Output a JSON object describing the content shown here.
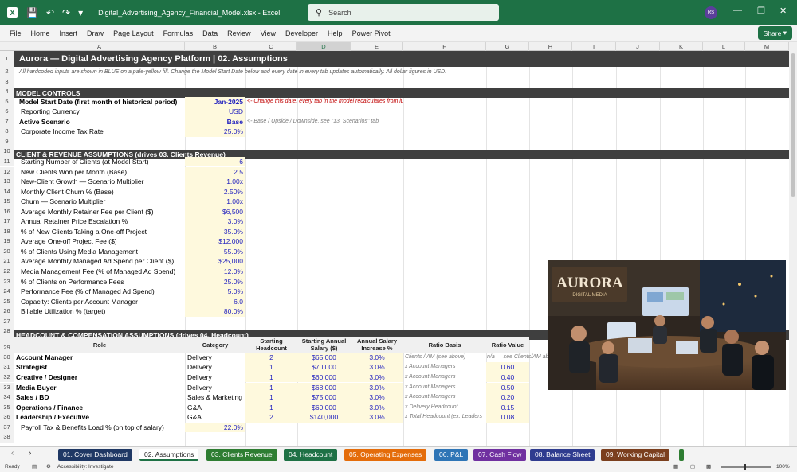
{
  "titlebar": {
    "filename": "Digital_Advertising_Agency_Financial_Model.xlsx",
    "app": "Excel",
    "search_placeholder": "Search",
    "avatar_initials": "RS"
  },
  "menu": [
    "File",
    "Home",
    "Insert",
    "Draw",
    "Page Layout",
    "Formulas",
    "Data",
    "Review",
    "View",
    "Developer",
    "Help",
    "Power Pivot"
  ],
  "share_label": "Share",
  "columns": [
    "A",
    "B",
    "C",
    "D",
    "E",
    "F",
    "G",
    "H",
    "I",
    "J",
    "K",
    "L",
    "M"
  ],
  "selected_column": "D",
  "rows": [
    "1",
    "2",
    "3",
    "4",
    "5",
    "6",
    "7",
    "8",
    "9",
    "10",
    "11",
    "12",
    "13",
    "14",
    "15",
    "16",
    "17",
    "18",
    "19",
    "20",
    "21",
    "22",
    "23",
    "24",
    "25",
    "26",
    "27",
    "28",
    "29",
    "30",
    "31",
    "32",
    "33",
    "34",
    "35",
    "36",
    "37",
    "38"
  ],
  "sheet": {
    "title": "Aurora — Digital Advertising Agency Platform  |  02. Assumptions",
    "subtitle": "All hardcoded inputs are shown in BLUE on a pale-yellow fill. Change the Model Start Date below and every date in every tab updates automatically. All dollar figures in USD.",
    "section_model_controls": "MODEL CONTROLS",
    "controls": [
      {
        "label": "Model Start Date  (first month of historical period)",
        "value": "Jan-2025",
        "bold": true,
        "note": "<- Change this date, every tab in the model recalculates from it.",
        "note_style": "red"
      },
      {
        "label": "Reporting Currency",
        "value": "USD",
        "bold": false,
        "note": "",
        "note_style": ""
      },
      {
        "label": "Active Scenario",
        "value": "Base",
        "bold": true,
        "note": "<- Base / Upside / Downside, see \"13. Scenarios\" tab",
        "note_style": "gray"
      },
      {
        "label": "Corporate Income Tax Rate",
        "value": "25.0%",
        "bold": false,
        "note": "",
        "note_style": ""
      }
    ],
    "section_client_revenue": "CLIENT & REVENUE ASSUMPTIONS  (drives 03. Clients Revenue)",
    "client_rows": [
      {
        "label": "Starting Number of Clients (at Model Start)",
        "value": "6"
      },
      {
        "label": "New Clients Won per Month (Base)",
        "value": "2.5"
      },
      {
        "label": "New-Client Growth — Scenario Multiplier",
        "value": "1.00x"
      },
      {
        "label": "Monthly Client Churn % (Base)",
        "value": "2.50%"
      },
      {
        "label": "Churn — Scenario Multiplier",
        "value": "1.00x"
      },
      {
        "label": "Average Monthly Retainer Fee per Client ($)",
        "value": "$6,500"
      },
      {
        "label": "Annual Retainer Price Escalation %",
        "value": "3.0%"
      },
      {
        "label": "% of New Clients Taking a One-off Project",
        "value": "35.0%"
      },
      {
        "label": "Average One-off Project Fee ($)",
        "value": "$12,000"
      },
      {
        "label": "% of Clients Using Media Management",
        "value": "55.0%"
      },
      {
        "label": "Average Monthly Managed Ad Spend per Client ($)",
        "value": "$25,000"
      },
      {
        "label": "Media Management Fee (% of Managed Ad Spend)",
        "value": "12.0%"
      },
      {
        "label": "% of Clients on Performance Fees",
        "value": "25.0%"
      },
      {
        "label": "Performance Fee (% of Managed Ad Spend)",
        "value": "5.0%"
      },
      {
        "label": "Capacity: Clients per Account Manager",
        "value": "6.0"
      },
      {
        "label": "Billable Utilization % (target)",
        "value": "80.0%"
      }
    ],
    "section_headcount": "HEADCOUNT & COMPENSATION ASSUMPTIONS  (drives 04. Headcount)",
    "headcount_headers": [
      "Role",
      "Category",
      "Starting Headcount",
      "Starting Annual Salary ($)",
      "Annual Salary Increase %",
      "Ratio Basis",
      "Ratio Value"
    ],
    "headcount_rows": [
      {
        "role": "Account Manager",
        "category": "Delivery",
        "headcount": "2",
        "salary": "$65,000",
        "increase": "3.0%",
        "basis": "Clients / AM (see above)",
        "ratio": "n/a — see Clients/AM above"
      },
      {
        "role": "Strategist",
        "category": "Delivery",
        "headcount": "1",
        "salary": "$70,000",
        "increase": "3.0%",
        "basis": "x Account Managers",
        "ratio": "0.60"
      },
      {
        "role": "Creative / Designer",
        "category": "Delivery",
        "headcount": "1",
        "salary": "$60,000",
        "increase": "3.0%",
        "basis": "x Account Managers",
        "ratio": "0.40"
      },
      {
        "role": "Media Buyer",
        "category": "Delivery",
        "headcount": "1",
        "salary": "$68,000",
        "increase": "3.0%",
        "basis": "x Account Managers",
        "ratio": "0.50"
      },
      {
        "role": "Sales / BD",
        "category": "Sales & Marketing",
        "headcount": "1",
        "salary": "$75,000",
        "increase": "3.0%",
        "basis": "x Account Managers",
        "ratio": "0.20"
      },
      {
        "role": "Operations / Finance",
        "category": "G&A",
        "headcount": "1",
        "salary": "$60,000",
        "increase": "3.0%",
        "basis": "x Delivery Headcount",
        "ratio": "0.15"
      },
      {
        "role": "Leadership / Executive",
        "category": "G&A",
        "headcount": "2",
        "salary": "$140,000",
        "increase": "3.0%",
        "basis": "x Total Headcount (ex. Leaders",
        "ratio": "0.08"
      }
    ],
    "payroll_label": "Payroll Tax & Benefits Load % (on top of salary)",
    "payroll_value": "22.0%"
  },
  "image": {
    "logo_text": "AURORA",
    "logo_sub": "DIGITAL MEDIA"
  },
  "tabs": [
    {
      "label": "01. Cover Dashboard",
      "color": "#1f3864",
      "active": false
    },
    {
      "label": "02. Assumptions",
      "color": "#ffffff",
      "active": true
    },
    {
      "label": "03. Clients Revenue",
      "color": "#2e7d32",
      "active": false
    },
    {
      "label": "04. Headcount",
      "color": "#1e7145",
      "active": false
    },
    {
      "label": "05. Operating Expenses",
      "color": "#e46c0a",
      "active": false
    },
    {
      "label": "06. P&L",
      "color": "#2e75b6",
      "active": false
    },
    {
      "label": "07. Cash Flow",
      "color": "#7030a0",
      "active": false
    },
    {
      "label": "08. Balance Sheet",
      "color": "#2f3c8f",
      "active": false
    },
    {
      "label": "09. Working Capital",
      "color": "#7b3f1e",
      "active": false
    }
  ],
  "status": {
    "ready": "Ready",
    "accessibility": "Accessibility: Investigate",
    "zoom": "100%"
  }
}
